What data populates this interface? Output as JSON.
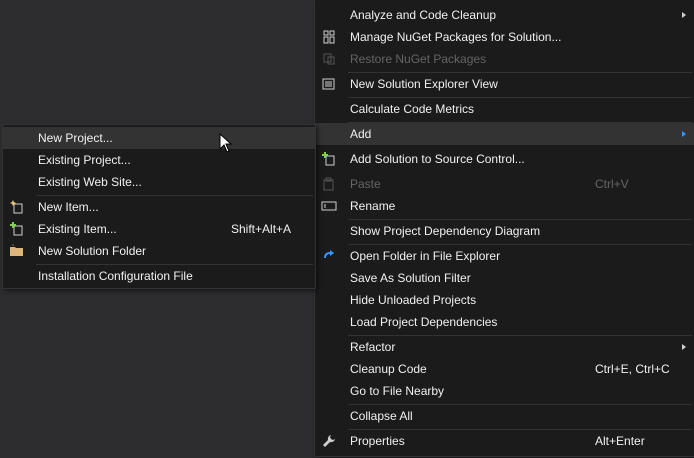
{
  "main_menu": {
    "analyze": "Analyze and Code Cleanup",
    "manage_nuget": "Manage NuGet Packages for Solution...",
    "restore_nuget": "Restore NuGet Packages",
    "new_view": "New Solution Explorer View",
    "calc_metrics": "Calculate Code Metrics",
    "add": "Add",
    "add_source_control": "Add Solution to Source Control...",
    "paste": "Paste",
    "paste_shortcut": "Ctrl+V",
    "rename": "Rename",
    "dependency_diagram": "Show Project Dependency Diagram",
    "open_folder": "Open Folder in File Explorer",
    "save_filter": "Save As Solution Filter",
    "hide_unloaded": "Hide Unloaded Projects",
    "load_deps": "Load Project Dependencies",
    "refactor": "Refactor",
    "cleanup": "Cleanup Code",
    "cleanup_shortcut": "Ctrl+E, Ctrl+C",
    "goto_file": "Go to File Nearby",
    "collapse_all": "Collapse All",
    "properties": "Properties",
    "properties_shortcut": "Alt+Enter"
  },
  "sub_menu": {
    "new_project": "New Project...",
    "existing_project": "Existing Project...",
    "existing_website": "Existing Web Site...",
    "new_item": "New Item...",
    "existing_item": "Existing Item...",
    "existing_item_shortcut": "Shift+Alt+A",
    "new_solution_folder": "New Solution Folder",
    "install_config": "Installation Configuration File"
  },
  "icons": {
    "nuget": "nuget-packages-icon",
    "restore": "restore-packages-icon",
    "new_view": "solution-view-icon",
    "add_source_control": "add-source-control-icon",
    "paste": "paste-icon",
    "rename": "rename-icon",
    "open_folder": "refresh-arrow-icon",
    "properties": "wrench-icon",
    "new_item": "new-item-icon",
    "existing_item": "existing-item-icon",
    "folder": "folder-icon"
  },
  "colors": {
    "menu_bg": "#1b1b1c",
    "window_bg": "#2d2d30",
    "text": "#f1f1f1",
    "disabled": "#656565",
    "highlight": "#333334",
    "accent": "#3399ff"
  }
}
